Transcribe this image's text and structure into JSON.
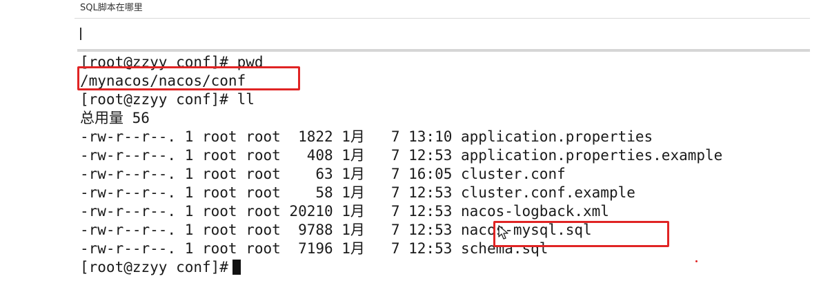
{
  "header": {
    "title": "SQL脚本在哪里"
  },
  "terminal": {
    "lines": [
      "[root@zzyy conf]# pwd",
      "/mynacos/nacos/conf",
      "[root@zzyy conf]# ll",
      "总用量 56",
      "-rw-r--r--. 1 root root  1822 1月   7 13:10 application.properties",
      "-rw-r--r--. 1 root root   408 1月   7 12:53 application.properties.example",
      "-rw-r--r--. 1 root root    63 1月   7 16:05 cluster.conf",
      "-rw-r--r--. 1 root root    58 1月   7 12:53 cluster.conf.example",
      "-rw-r--r--. 1 root root 20210 1月   7 12:53 nacos-logback.xml",
      "-rw-r--r--. 1 root root  9788 1月   7 12:53 nacos-mysql.sql",
      "-rw-r--r--. 1 root root  7196 1月   7 12:53 schema.sql",
      "[root@zzyy conf]#"
    ]
  },
  "colors": {
    "highlight": "#e02424",
    "terminal_text": "#1a1a1a"
  },
  "icons": {
    "pointer": "mouse-pointer-icon"
  }
}
